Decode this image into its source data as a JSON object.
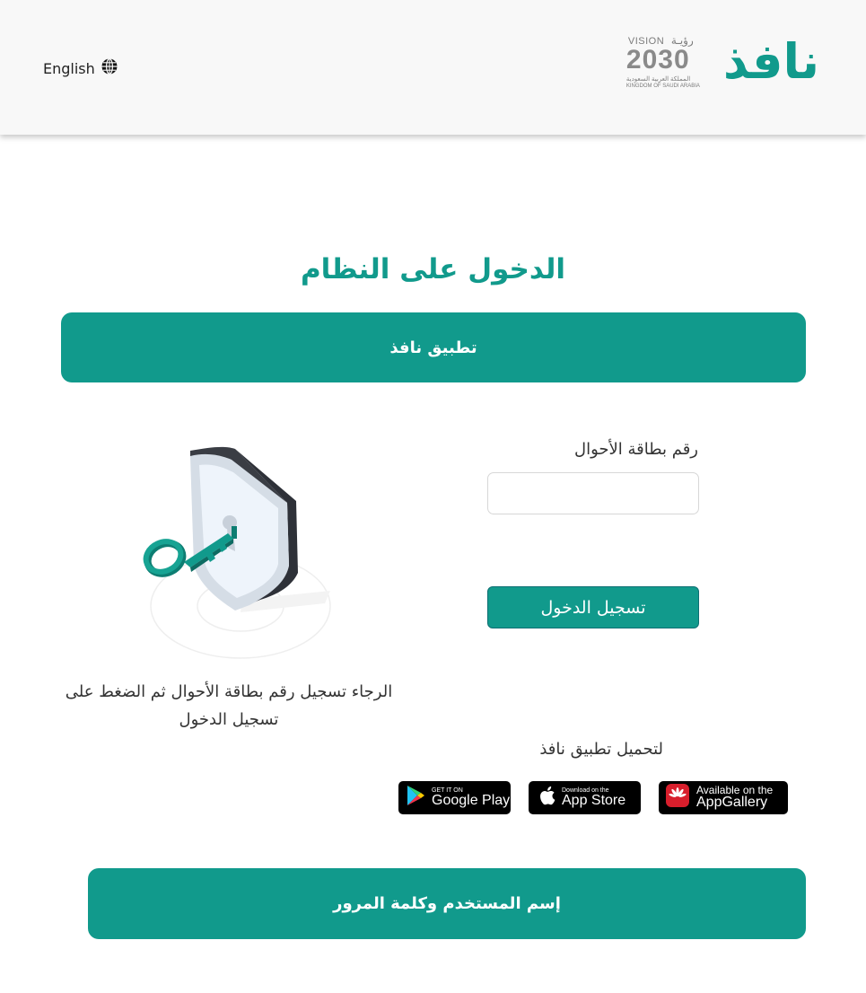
{
  "header": {
    "language_label": "English",
    "logo_text": "نافذ",
    "vision": {
      "vision_en": "VISION",
      "vision_ar": "رؤيـة",
      "year": "2030",
      "kingdom_ar": "المملكة العربية السعودية",
      "kingdom_en": "KINGDOM OF SAUDI ARABIA"
    }
  },
  "page": {
    "title": "الدخول على النظام"
  },
  "tabs": {
    "nafath_app": "تطبيق نافذ",
    "username_password": "إسم المستخدم وكلمة المرور"
  },
  "form": {
    "id_label": "رقم بطاقة الأحوال",
    "id_value": "",
    "login_button": "تسجيل الدخول"
  },
  "hint": "الرجاء تسجيل رقم بطاقة الأحوال ثم الضغط على تسجيل الدخول",
  "download": {
    "label": "لتحميل تطبيق نافذ",
    "google_play": {
      "small": "GET IT ON",
      "big": "Google Play"
    },
    "app_store": {
      "small": "Download on the",
      "big": "App Store"
    },
    "app_gallery": {
      "small": "Available on the",
      "big": "AppGallery"
    }
  },
  "colors": {
    "primary": "#119a8c",
    "header_bg": "#f8f8f8",
    "text": "#333333"
  }
}
